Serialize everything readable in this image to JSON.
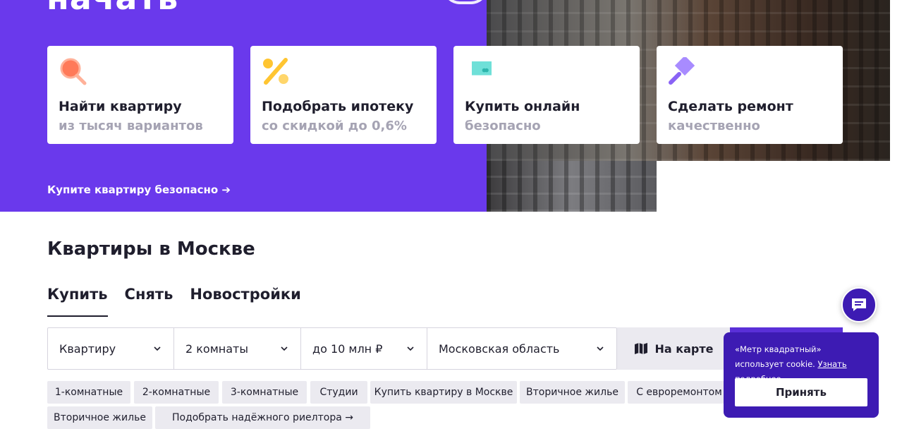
{
  "hero": {
    "title_fragment": "начать",
    "cards": [
      {
        "icon": "magnifier-icon",
        "title": "Найти квартиру",
        "subtitle": "из тысяч вариантов"
      },
      {
        "icon": "percent-icon",
        "title": "Подобрать ипотеку",
        "subtitle": "со скидкой до 0,6%"
      },
      {
        "icon": "card-icon",
        "title": "Купить онлайн",
        "subtitle": "безопасно"
      },
      {
        "icon": "paint-roller-icon",
        "title": "Сделать ремонт",
        "subtitle": "качественно"
      }
    ],
    "link": "Купите квартиру безопасно ➔",
    "colors": {
      "brand": "#6a39ec"
    }
  },
  "search": {
    "title": "Квартиры в Москве",
    "tabs": [
      {
        "label": "Купить",
        "active": true
      },
      {
        "label": "Снять",
        "active": false
      },
      {
        "label": "Новостройки",
        "active": false
      }
    ],
    "filters": {
      "type": "Квартиру",
      "rooms": "2 комнаты",
      "price": "до 10 млн ₽",
      "region": "Московская область"
    },
    "map_button": "На карте",
    "chips": [
      "1-комнатные",
      "2-комнатные",
      "3-комнатные",
      "Студии",
      "Купить квартиру в Москве",
      "Вторичное жилье",
      "С евроремонтом",
      "Вторичное жилье",
      "Подобрать надёжного риелтора →"
    ]
  },
  "chat": {
    "icon": "chat-icon"
  },
  "cookie": {
    "text": "«Метр квадратный» использует cookie.",
    "more": "Узнать подробнее",
    "period": ".",
    "accept": "Принять"
  }
}
